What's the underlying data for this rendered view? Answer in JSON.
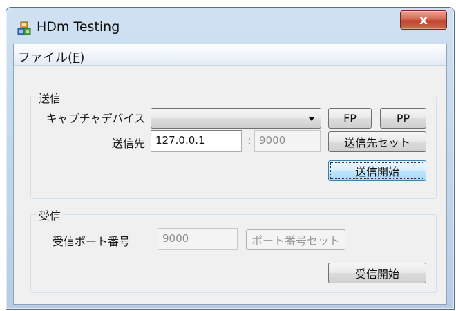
{
  "window": {
    "title": "HDm Testing",
    "close_label": "x",
    "app_icon": "app-icon"
  },
  "menu": {
    "file_label_main": "ファイル(",
    "file_label_mnemonic": "F",
    "file_label_end": ")"
  },
  "send_group": {
    "label": "送信",
    "capture_device_label": "キャプチャデバイス",
    "capture_device_value": "",
    "fp_button": "FP",
    "pp_button": "PP",
    "destination_label": "送信先",
    "ip_value": "127.0.0.1",
    "separator": ":",
    "port_value": "9000",
    "set_destination_button": "送信先セット",
    "start_send_button": "送信開始"
  },
  "receive_group": {
    "label": "受信",
    "port_label": "受信ポート番号",
    "port_value": "9000",
    "set_port_button": "ポート番号セット",
    "start_receive_button": "受信開始"
  },
  "colors": {
    "close_button": "#c94a33",
    "default_button_border": "#3c7fb1",
    "title_bar": "#c3d7ec"
  }
}
